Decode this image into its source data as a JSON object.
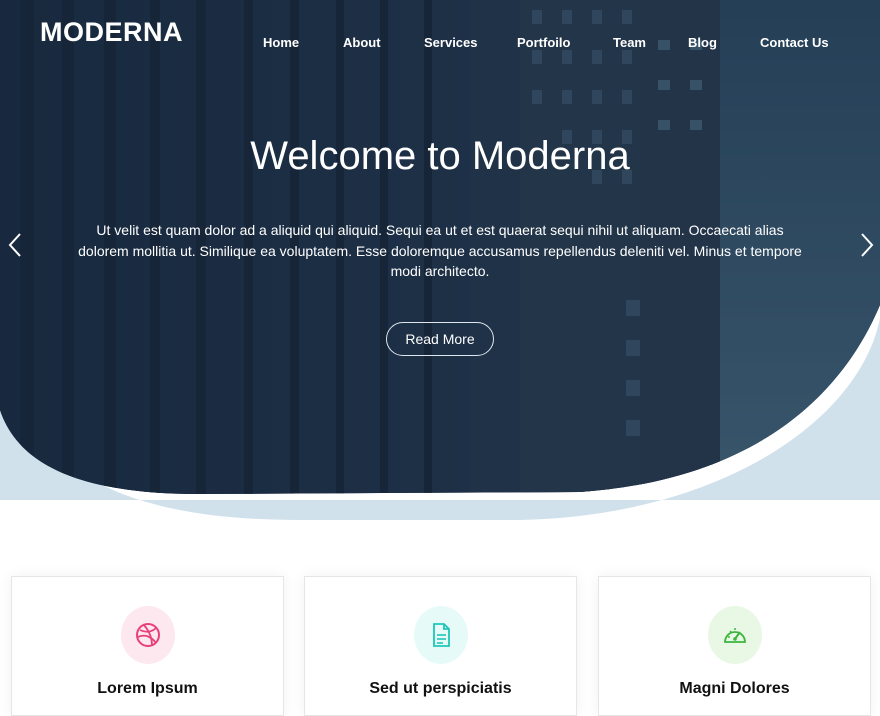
{
  "brand": {
    "logo": "MODERNA"
  },
  "nav": [
    {
      "label": "Home"
    },
    {
      "label": "About"
    },
    {
      "label": "Services"
    },
    {
      "label": "Portfoilo"
    },
    {
      "label": "Team"
    },
    {
      "label": "Blog"
    },
    {
      "label": "Contact Us"
    }
  ],
  "hero": {
    "title": "Welcome to Moderna",
    "text": "Ut velit est quam dolor ad a aliquid qui aliquid. Sequi ea ut et est quaerat sequi nihil ut aliquam. Occaecati alias dolorem mollitia ut. Similique ea voluptatem. Esse doloremque accusamus repellendus deleniti vel. Minus et tempore modi architecto.",
    "button": "Read More",
    "prev_icon": "chevron-left-icon",
    "next_icon": "chevron-right-icon"
  },
  "cards": [
    {
      "title": "Lorem Ipsum",
      "icon": "dribbble-icon",
      "icon_color": "#e9407b",
      "icon_bg": "#fde8ef"
    },
    {
      "title": "Sed ut perspiciatis",
      "icon": "document-icon",
      "icon_color": "#1fc7b8",
      "icon_bg": "#e6fbf8"
    },
    {
      "title": "Magni Dolores",
      "icon": "speedometer-icon",
      "icon_color": "#3ab53e",
      "icon_bg": "#e8f8e4"
    }
  ],
  "colors": {
    "hero_overlay": "#1a2d45",
    "hero_wave": "#d0e1ec",
    "text_dark": "#111111"
  }
}
